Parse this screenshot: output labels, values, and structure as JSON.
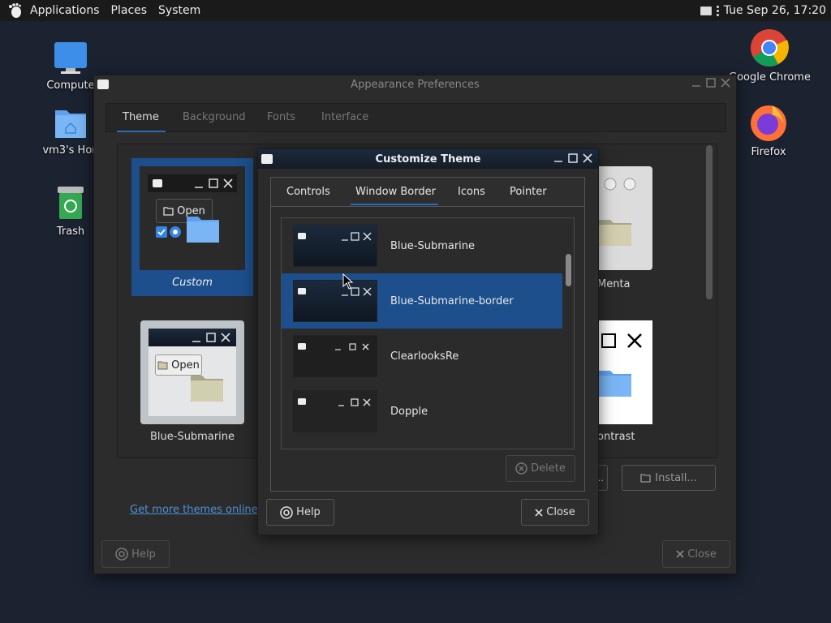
{
  "panel": {
    "menus": [
      "Applications",
      "Places",
      "System"
    ],
    "clock": "Tue Sep 26, 17:20"
  },
  "desktop": {
    "computer": "Compute",
    "home": "vm3's Hon",
    "trash": "Trash",
    "chrome": "Google Chrome",
    "firefox": "Firefox"
  },
  "appearance": {
    "title": "Appearance Preferences",
    "tabs": [
      "Theme",
      "Background",
      "Fonts",
      "Interface"
    ],
    "themes": {
      "custom": "Custom",
      "custom_open": "Open",
      "menta": "Menta",
      "blue_submarine": "Blue-Submarine",
      "blue_open": "Open",
      "contrast": "ontrast"
    },
    "get_more_link": "Get more themes online",
    "install_label": "Install...",
    "partial_button": "...",
    "help_label": "Help",
    "close_label": "Close"
  },
  "customize": {
    "title": "Customize Theme",
    "tabs": [
      "Controls",
      "Window Border",
      "Icons",
      "Pointer"
    ],
    "active_tab": "Window Border",
    "items": [
      "Blue-Submarine",
      "Blue-Submarine-border",
      "ClearlooksRe",
      "Dopple"
    ],
    "selected": "Blue-Submarine-border",
    "delete_label": "Delete",
    "help_label": "Help",
    "close_label": "Close"
  },
  "colors": {
    "selection": "#1c4f8c",
    "tab_underline": "#2a6bb7",
    "link": "#4e8fd9"
  }
}
